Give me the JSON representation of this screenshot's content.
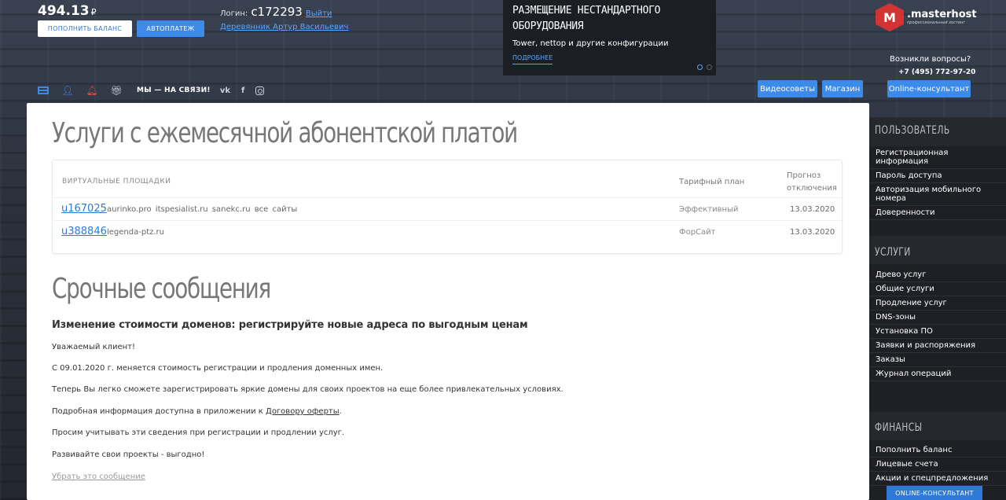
{
  "header": {
    "balance_value": "494.13",
    "balance_currency": "₽",
    "topup_label": "ПОПОЛНИТЬ БАЛАНС",
    "autopay_label": "АВТОПЛАТЕЖ",
    "login_label": "Логин:",
    "login_code": "c172293",
    "exit_label": "Выйти",
    "user_name": "Деревянник Артур Васильевич",
    "social_label": "МЫ — НА СВЯЗИ!",
    "social_vk": "vk",
    "social_fb": "f"
  },
  "promo": {
    "title_line1": "РАЗМЕЩЕНИЕ НЕСТАНДАРТНОГО",
    "title_line2": "ОБОРУДОВАНИЯ",
    "subtitle": "Tower, nettop и другие конфигурации",
    "more_label": "ПОДРОБНЕЕ"
  },
  "nav_buttons": {
    "video_label": "Видеосоветы",
    "shop_label": "Магазин",
    "online_label": "Online-консультант"
  },
  "brand": {
    "name": ".masterhost",
    "tagline": "профессиональный хостинг",
    "help_question": "Возникли вопросы?",
    "phone": "+7 (495) 772-97-20"
  },
  "services": {
    "title": "Услуги с ежемесячной абонентской платой",
    "col_sites": "ВИРТУАЛЬНЫЕ ПЛОЩАДКИ",
    "col_plan": "Тарифный план",
    "col_forecast": "Прогноз отключения",
    "rows": [
      {
        "account": "u167025",
        "sites": "aurinko.pro  itspesialist.ru  sanekc.ru  все сайты",
        "plan": "Эффективный",
        "date": "13.03.2020"
      },
      {
        "account": "u388846",
        "sites": "legenda-ptz.ru",
        "plan": "ФорСайт",
        "date": "13.03.2020"
      }
    ]
  },
  "urgent": {
    "title": "Срочные сообщения",
    "msg_title": "Изменение стоимости доменов: регистрируйте новые адреса по выгодным ценам",
    "p1": "Уважаемый клиент!",
    "p2": "С 09.01.2020 г. меняется стоимость регистрации и продления доменных имен.",
    "p3": "Теперь Вы легко сможете зарегистрировать яркие домены для своих проектов на еще более привлекательных условиях.",
    "p4_prefix": "Подробная информация доступна в приложении к ",
    "p4_link": "Договору оферты",
    "p4_suffix": ".",
    "p5": "Просим учитывать эти сведения при регистрации и продлении услуг.",
    "p6": "Развивайте свои проекты - выгодно!",
    "hide_label": "Убрать это сообщение"
  },
  "sidebar": {
    "user_title": "ПОЛЬЗОВАТЕЛЬ",
    "user_items": [
      "Регистрационная информация",
      "Пароль доступа",
      "Авторизация мобильного номера",
      "Доверенности"
    ],
    "services_title": "УСЛУГИ",
    "services_items": [
      "Древо услуг",
      "Общие услуги",
      "Продление услуг",
      "DNS-зоны",
      "Установка ПО",
      "Заявки и распоряжения",
      "Заказы",
      "Журнал операций"
    ],
    "finance_title": "ФИНАНСЫ",
    "finance_items": [
      "Пополнить баланс",
      "Лицевые счета",
      "Акции и спецпредложения"
    ],
    "bottom_online": "ONLINE-КОНСУЛЬТАНТ"
  },
  "colors": {
    "accent": "#3d8be8",
    "link": "#2f7ad8",
    "brand_red": "#d23434",
    "sidebar_bg": "#1e2026"
  }
}
